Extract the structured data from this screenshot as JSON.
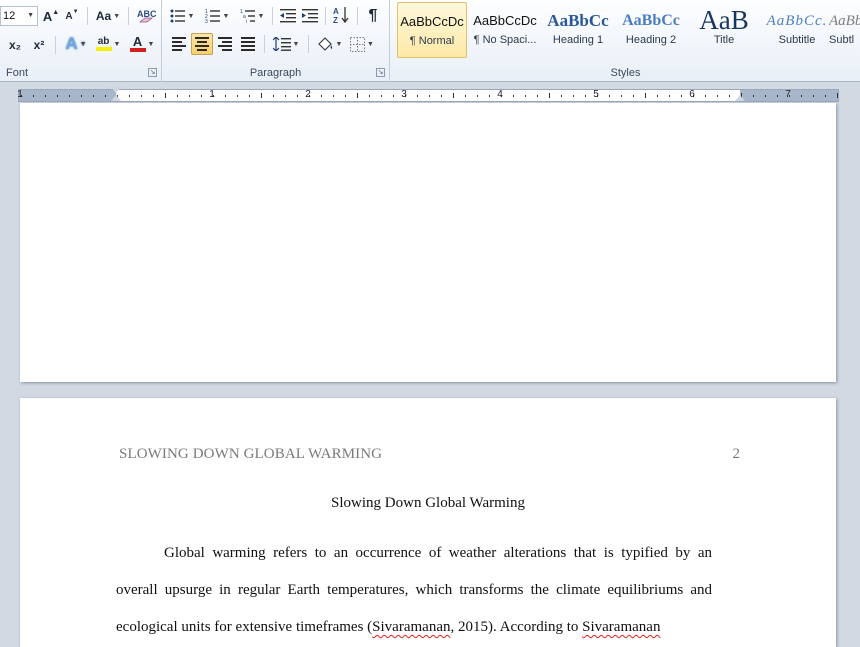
{
  "ribbon": {
    "font_group": {
      "label": "Font",
      "font_size": "12",
      "grow_font": "A",
      "shrink_font": "A",
      "change_case": "Aa",
      "subscript": "x₂",
      "superscript": "x²",
      "text_effects": "A",
      "highlight": "ab",
      "font_color": "A"
    },
    "paragraph_group": {
      "label": "Paragraph",
      "show_marks": "¶"
    },
    "styles_group": {
      "label": "Styles",
      "styles": [
        {
          "sample": "AaBbCcDc",
          "name": "¶ Normal"
        },
        {
          "sample": "AaBbCcDc",
          "name": "¶ No Spaci..."
        },
        {
          "sample": "AaBbCc",
          "name": "Heading 1"
        },
        {
          "sample": "AaBbCc",
          "name": "Heading 2"
        },
        {
          "sample": "AaB",
          "name": "Title"
        },
        {
          "sample": "AaBbCc.",
          "name": "Subtitle"
        },
        {
          "sample": "AaBb",
          "name": "Subtl"
        }
      ]
    },
    "colors": {
      "highlight_bar": "#f5f000",
      "font_color_bar": "#d02020",
      "active_button": "#f8cf6b"
    }
  },
  "ruler": {
    "numbers": [
      "1",
      "1",
      "2",
      "3",
      "4",
      "5",
      "6",
      "7"
    ]
  },
  "document": {
    "running_head": "SLOWING DOWN GLOBAL WARMING",
    "page_number": "2",
    "title": "Slowing Down Global Warming",
    "paragraph_lines": [
      "Global warming refers to an occurrence of weather alterations that is typified by an",
      "overall upsurge in regular Earth temperatures, which transforms the climate equilibriums and"
    ],
    "line3_before": "ecological units for extensive timeframes (",
    "citation_author": "Sivaramanan",
    "line3_middle": ", 2015). According to ",
    "line3_author2": "Sivaramanan"
  }
}
